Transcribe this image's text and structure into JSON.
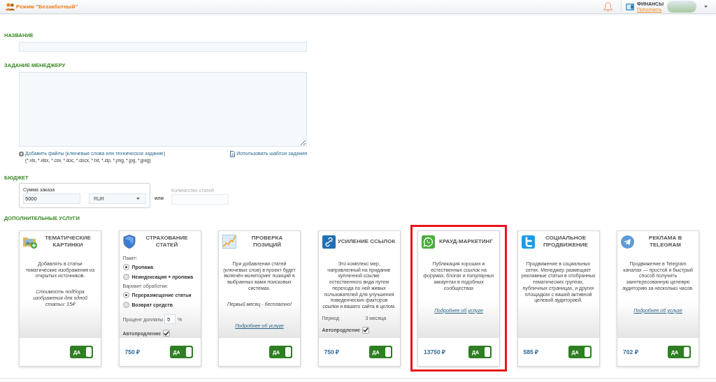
{
  "header": {
    "mode_title": "Режим \"Беззаботный\"",
    "finance_label": "ФИНАНСЫ",
    "top_up_link": "Пополнить"
  },
  "title_field": {
    "label": "НАЗВАНИЕ"
  },
  "task_field": {
    "label": "ЗАДАНИЕ МЕНЕДЖЕРУ",
    "attach_link": "Добавить файлы (ключевые слова или техническое задание)",
    "attach_formats": "(*.xls, *.xlsx, *.csv, *.doc, *.docx, *.txt, *.zip, *.png, *.jpg, *.jpeg)",
    "template_link": "Использовать шаблон задания"
  },
  "budget": {
    "label": "БЮДЖЕТ",
    "amount_label": "Сумма заказа",
    "amount_value": "5000",
    "currency": "RUR",
    "separator": "или",
    "count": {
      "label": "Количество статей",
      "disabled": true
    }
  },
  "extras": {
    "label": "ДОПОЛНИТЕЛЬНЫЕ УСЛУГИ",
    "cards": [
      {
        "title": "ТЕМАТИЧЕСКИЕ КАРТИНКИ",
        "highlighted": false,
        "body": [
          {
            "kind": "text",
            "text": "Добавлять в статьи тематические изображения из открытых источников."
          },
          {
            "kind": "note",
            "text": "Стоимость подбора изображения для одной статьи: 15₽"
          }
        ],
        "toggle": {
          "label": "ДА",
          "on": true
        }
      },
      {
        "title": "СТРАХОВАНИЕ СТАТЕЙ",
        "highlighted": false,
        "body": [
          {
            "kind": "radios",
            "label": "Пакет:",
            "options": [
              {
                "label": "Пропажа",
                "selected": true
              },
              {
                "label": "Неиндексация + пропажа",
                "selected": false
              }
            ]
          },
          {
            "kind": "radios",
            "label": "Вариант обработки:",
            "options": [
              {
                "label": "Переразмещение статьи",
                "selected": true
              },
              {
                "label": "Возврат средств",
                "selected": false
              }
            ]
          },
          {
            "kind": "number",
            "label": "Процент доплаты",
            "value": "5",
            "unit": "%"
          },
          {
            "kind": "checkbox",
            "label": "Автопродление",
            "checked": true
          }
        ],
        "price": "750 ₽",
        "toggle": {
          "label": "ДА",
          "on": true
        }
      },
      {
        "title": "ПРОВЕРКА ПОЗИЦИЙ",
        "highlighted": false,
        "body": [
          {
            "kind": "text",
            "text": "При добавлении статей (ключевых слов) в проект будет включён мониторинг позиций в выбранных вами поисковых системах."
          },
          {
            "kind": "note",
            "text": "Первый месяц - бесплатно!"
          },
          {
            "kind": "link",
            "text": "Подробнее об услуге"
          }
        ],
        "toggle": {
          "label": "ДА",
          "on": true
        }
      },
      {
        "title": "УСИЛЕНИЕ ССЫЛОК",
        "highlighted": false,
        "body": [
          {
            "kind": "text",
            "text": "Это комплекс мер, направленный на придание купленной ссылке естественного вида путем перехода по ней живых пользователей для улучшения поведенческих факторов ссылки и вашего сайта в целом."
          },
          {
            "kind": "pair",
            "label": "Период",
            "value": "3 месяца"
          },
          {
            "kind": "checkbox",
            "label": "Автопродление",
            "checked": true
          }
        ],
        "price": "750 ₽",
        "toggle": {
          "label": "ДА",
          "on": true
        }
      },
      {
        "title": "КРАУД-МАРКЕТИНГ",
        "highlighted": true,
        "body": [
          {
            "kind": "text",
            "text": "Публикация хороших и естественных ссылок на форумах, блогах и популярных аккаунтах в подобных сообществах"
          },
          {
            "kind": "link",
            "text": "Подробнее об услуге"
          }
        ],
        "price": "13750 ₽",
        "toggle": {
          "label": "ДА",
          "on": true
        }
      },
      {
        "title": "СОЦИАЛЬНОЕ ПРОДВИЖЕНИЕ",
        "highlighted": false,
        "body": [
          {
            "kind": "text",
            "text": "Продвижение в социальных сетях. Менеджер размещает рекламные статьи в отобранных тематических группах, публичных страницах, и других площадках с вашей активной целевой аудиторией."
          }
        ],
        "price": "585 ₽",
        "toggle": {
          "label": "ДА",
          "on": true
        }
      },
      {
        "title": "РЕКЛАМА В TELEGRAM",
        "highlighted": false,
        "body": [
          {
            "kind": "text",
            "text": "Продвижение в Telegram каналах — простой и быстрый способ получить заинтересованную целевую аудиторию за несколько часов."
          },
          {
            "kind": "link",
            "text": "Подробнее об услуге"
          }
        ],
        "price": "702 ₽",
        "toggle": {
          "label": "ДА",
          "on": true
        }
      }
    ]
  }
}
